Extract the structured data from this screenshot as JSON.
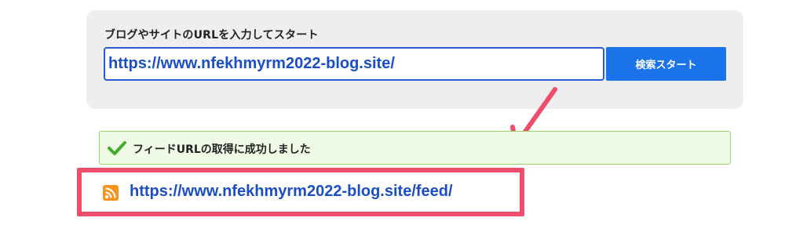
{
  "search": {
    "prompt": "ブログやサイトのURLを入力してスタート",
    "input_value": "https://www.nfekhmyrm2022-blog.site/",
    "button_label": "検索スタート"
  },
  "result": {
    "success_message": "フィードURLの取得に成功しました",
    "feed_url": "https://www.nfekhmyrm2022-blog.site/feed/"
  },
  "colors": {
    "primary": "#1a73e8",
    "link": "#1a4ec4",
    "success_bg": "#f0fbe6",
    "success_border": "#9bd468",
    "check": "#3fae2a",
    "highlight": "#ee4d6b",
    "rss": "#f7931e"
  },
  "icons": {
    "check": "check-icon",
    "rss": "rss-icon",
    "annotation_arrow": "arrow-icon"
  }
}
